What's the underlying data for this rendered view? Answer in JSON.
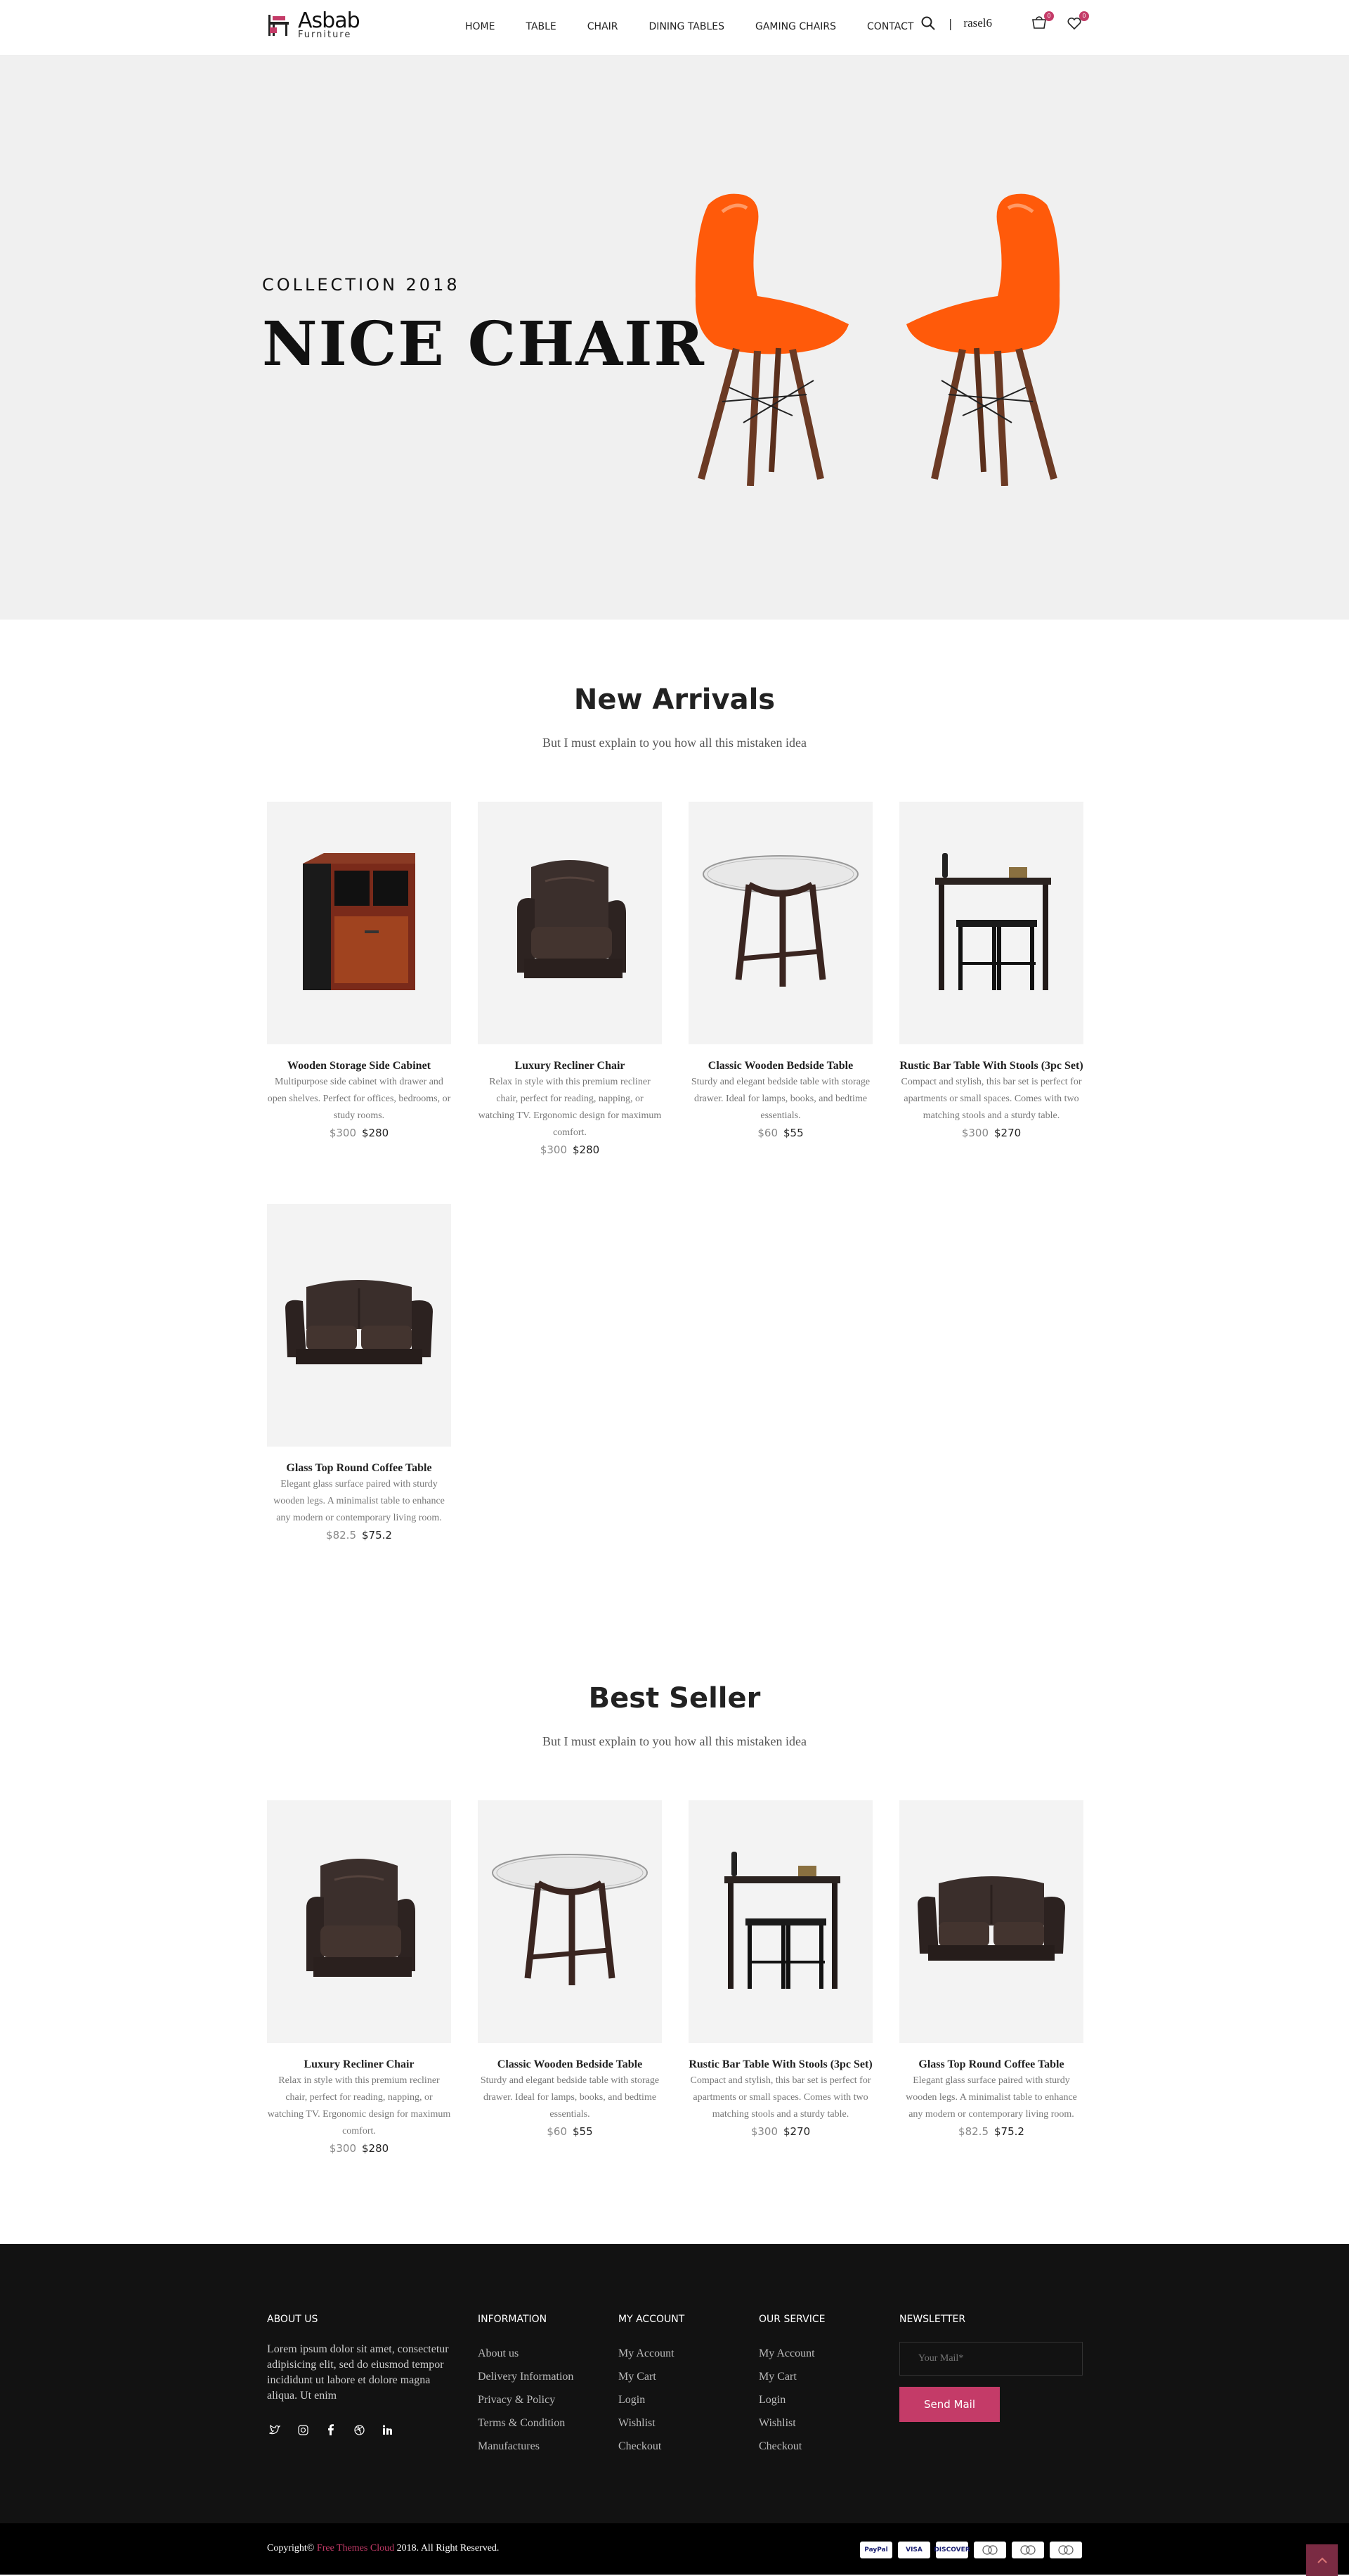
{
  "header": {
    "logo_main": "Asbab",
    "logo_sub": "Furniture",
    "nav": [
      "HOME",
      "TABLE",
      "CHAIR",
      "DINING TABLES",
      "GAMING CHAIRS",
      "CONTACT"
    ],
    "separator": "|",
    "user": "rasel6",
    "cart_count": "0",
    "wishlist_count": "0"
  },
  "hero": {
    "subtitle": "COLLECTION 2018",
    "title": "NICE CHAIR",
    "chair_color": "#ff5a0a"
  },
  "new_arrivals": {
    "title": "New Arrivals",
    "subtitle": "But I must explain to you how all this mistaken idea",
    "items": [
      {
        "title": "Wooden Storage Side Cabinet",
        "desc": "Multipurpose side cabinet with drawer and open shelves. Perfect for offices, bedrooms, or study rooms.",
        "old": "$300",
        "new": "$280",
        "icon": "cabinet"
      },
      {
        "title": "Luxury Recliner Chair",
        "desc": "Relax in style with this premium recliner chair, perfect for reading, napping, or watching TV. Ergonomic design for maximum comfort.",
        "old": "$300",
        "new": "$280",
        "icon": "recliner"
      },
      {
        "title": "Classic Wooden Bedside Table",
        "desc": "Sturdy and elegant bedside table with storage drawer. Ideal for lamps, books, and bedtime essentials.",
        "old": "$60",
        "new": "$55",
        "icon": "glass-table"
      },
      {
        "title": "Rustic Bar Table With Stools (3pc Set)",
        "desc": "Compact and stylish, this bar set is perfect for apartments or small spaces. Comes with two matching stools and a sturdy table.",
        "old": "$300",
        "new": "$270",
        "icon": "bar-set"
      },
      {
        "title": "Glass Top Round Coffee Table",
        "desc": "Elegant glass surface paired with sturdy wooden legs. A minimalist table to enhance any modern or contemporary living room.",
        "old": "$82.5",
        "new": "$75.2",
        "icon": "loveseat"
      }
    ]
  },
  "best_seller": {
    "title": "Best Seller",
    "subtitle": "But I must explain to you how all this mistaken idea",
    "items": [
      {
        "title": "Luxury Recliner Chair",
        "desc": "Relax in style with this premium recliner chair, perfect for reading, napping, or watching TV. Ergonomic design for maximum comfort.",
        "old": "$300",
        "new": "$280",
        "icon": "recliner"
      },
      {
        "title": "Classic Wooden Bedside Table",
        "desc": "Sturdy and elegant bedside table with storage drawer. Ideal for lamps, books, and bedtime essentials.",
        "old": "$60",
        "new": "$55",
        "icon": "glass-table"
      },
      {
        "title": "Rustic Bar Table With Stools (3pc Set)",
        "desc": "Compact and stylish, this bar set is perfect for apartments or small spaces. Comes with two matching stools and a sturdy table.",
        "old": "$300",
        "new": "$270",
        "icon": "bar-set"
      },
      {
        "title": "Glass Top Round Coffee Table",
        "desc": "Elegant glass surface paired with sturdy wooden legs. A minimalist table to enhance any modern or contemporary living room.",
        "old": "$82.5",
        "new": "$75.2",
        "icon": "loveseat"
      }
    ]
  },
  "footer": {
    "about": {
      "heading": "ABOUT US",
      "text": "Lorem ipsum dolor sit amet, consectetur adipisicing elit, sed do eiusmod tempor incididunt ut labore et dolore magna aliqua. Ut enim"
    },
    "information": {
      "heading": "INFORMATION",
      "links": [
        "About us",
        "Delivery Information",
        "Privacy & Policy",
        "Terms & Condition",
        "Manufactures"
      ]
    },
    "account": {
      "heading": "MY ACCOUNT",
      "links": [
        "My Account",
        "My Cart",
        "Login",
        "Wishlist",
        "Checkout"
      ]
    },
    "service": {
      "heading": "OUR SERVICE",
      "links": [
        "My Account",
        "My Cart",
        "Login",
        "Wishlist",
        "Checkout"
      ]
    },
    "newsletter": {
      "heading": "NEWSLETTER",
      "placeholder": "Your Mail*",
      "button": "Send Mail"
    },
    "social": [
      "twitter-icon",
      "instagram-icon",
      "facebook-icon",
      "dribbble-icon",
      "linkedin-icon"
    ]
  },
  "bottom": {
    "copyright_prefix": "Copyright© ",
    "copyright_brand": "Free Themes Cloud",
    "copyright_suffix": " 2018. All Right Reserved.",
    "payments": [
      "PayPal",
      "VISA",
      "DISCOVER",
      "",
      "",
      ""
    ],
    "accent": "#c43b68"
  }
}
